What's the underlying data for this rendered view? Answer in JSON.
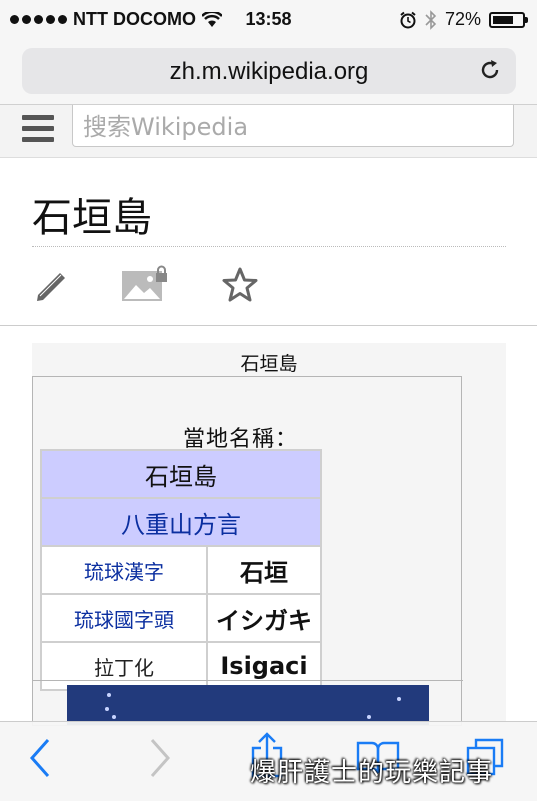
{
  "status": {
    "carrier": "NTT DOCOMO",
    "time": "13:58",
    "battery": "72%",
    "battery_level": 0.72
  },
  "browser": {
    "url": "zh.m.wikipedia.org"
  },
  "wiki": {
    "search_placeholder": "搜索Wikipedia",
    "title": "石垣島"
  },
  "infobox": {
    "caption": "石垣島",
    "local_name_label": "當地名稱：",
    "name_header": "石垣島",
    "dialect": "八重山方言",
    "rows": [
      {
        "label": "琉球漢字",
        "value": "石垣"
      },
      {
        "label": "琉球國字頭",
        "value": "イシガキ"
      },
      {
        "label": "拉丁化",
        "value": "Isigaci"
      }
    ]
  },
  "watermark": "爆肝護士的玩樂記事",
  "icons": {
    "menu": "hamburger-menu-icon",
    "edit": "pencil-icon",
    "upload": "locked-image-icon",
    "watch": "star-icon",
    "back": "chevron-left-icon",
    "forward": "chevron-right-icon",
    "share": "share-icon",
    "bookmarks": "book-icon",
    "tabs": "tabs-icon"
  },
  "colors": {
    "accent_blue": "#1a7cf5",
    "link_blue": "#0b2fa0",
    "infobox_header": "#ccccff"
  }
}
